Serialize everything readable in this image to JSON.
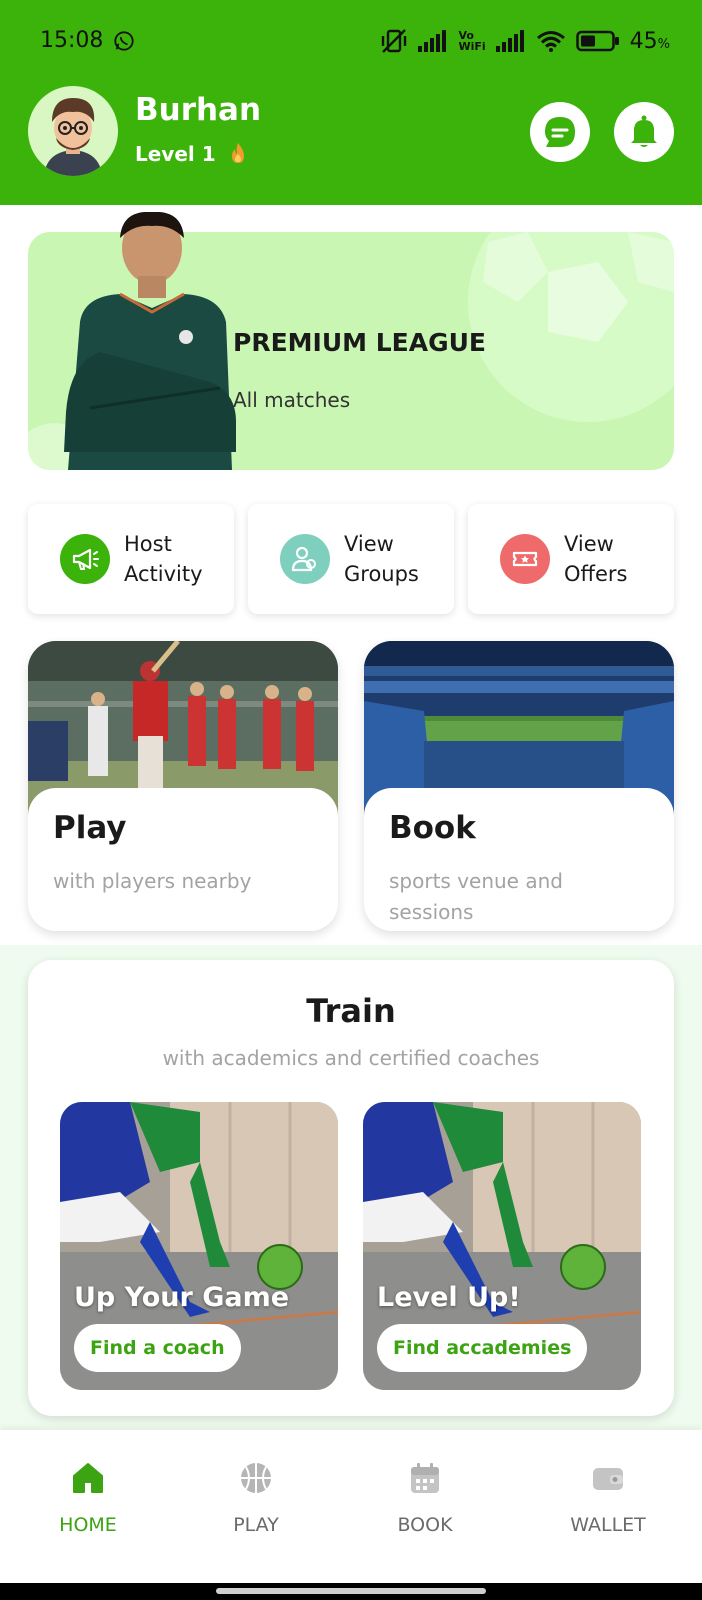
{
  "status_bar": {
    "time": "15:08",
    "battery": "45",
    "battery_unit": "%",
    "network_label_top": "Vo",
    "network_label_bottom": "WiFi"
  },
  "header": {
    "user_name": "Burhan",
    "level": "Level 1",
    "chat_icon": "chat-bubble-icon",
    "notification_icon": "bell-icon",
    "background_color": "#3cb30a"
  },
  "banner": {
    "title": "PREMIUM LEAGUE",
    "subtitle": "All matches",
    "background_color": "#c9f7b3"
  },
  "quick_actions": [
    {
      "line1": "Host",
      "line2": "Activity",
      "icon": "megaphone-icon",
      "color": "#3cb30a"
    },
    {
      "line1": "View",
      "line2": "Groups",
      "icon": "group-icon",
      "color": "#7fcfbf"
    },
    {
      "line1": "View",
      "line2": "Offers",
      "icon": "ticket-icon",
      "color": "#ef6b6b"
    }
  ],
  "cards": {
    "play": {
      "title": "Play",
      "subtitle": "with players nearby"
    },
    "book": {
      "title": "Book",
      "subtitle": "sports venue and sessions"
    }
  },
  "train": {
    "title": "Train",
    "subtitle": "with academics and certified coaches",
    "tiles": [
      {
        "title": "Up Your Game",
        "button": "Find a coach"
      },
      {
        "title": "Level Up!",
        "button": "Find accademies"
      }
    ]
  },
  "bottom_nav": {
    "items": [
      {
        "label": "HOME",
        "icon": "home-icon",
        "active": true
      },
      {
        "label": "PLAY",
        "icon": "basketball-icon",
        "active": false
      },
      {
        "label": "BOOK",
        "icon": "calendar-icon",
        "active": false
      },
      {
        "label": "WALLET",
        "icon": "wallet-icon",
        "active": false
      }
    ],
    "active_color": "#3ca312"
  }
}
